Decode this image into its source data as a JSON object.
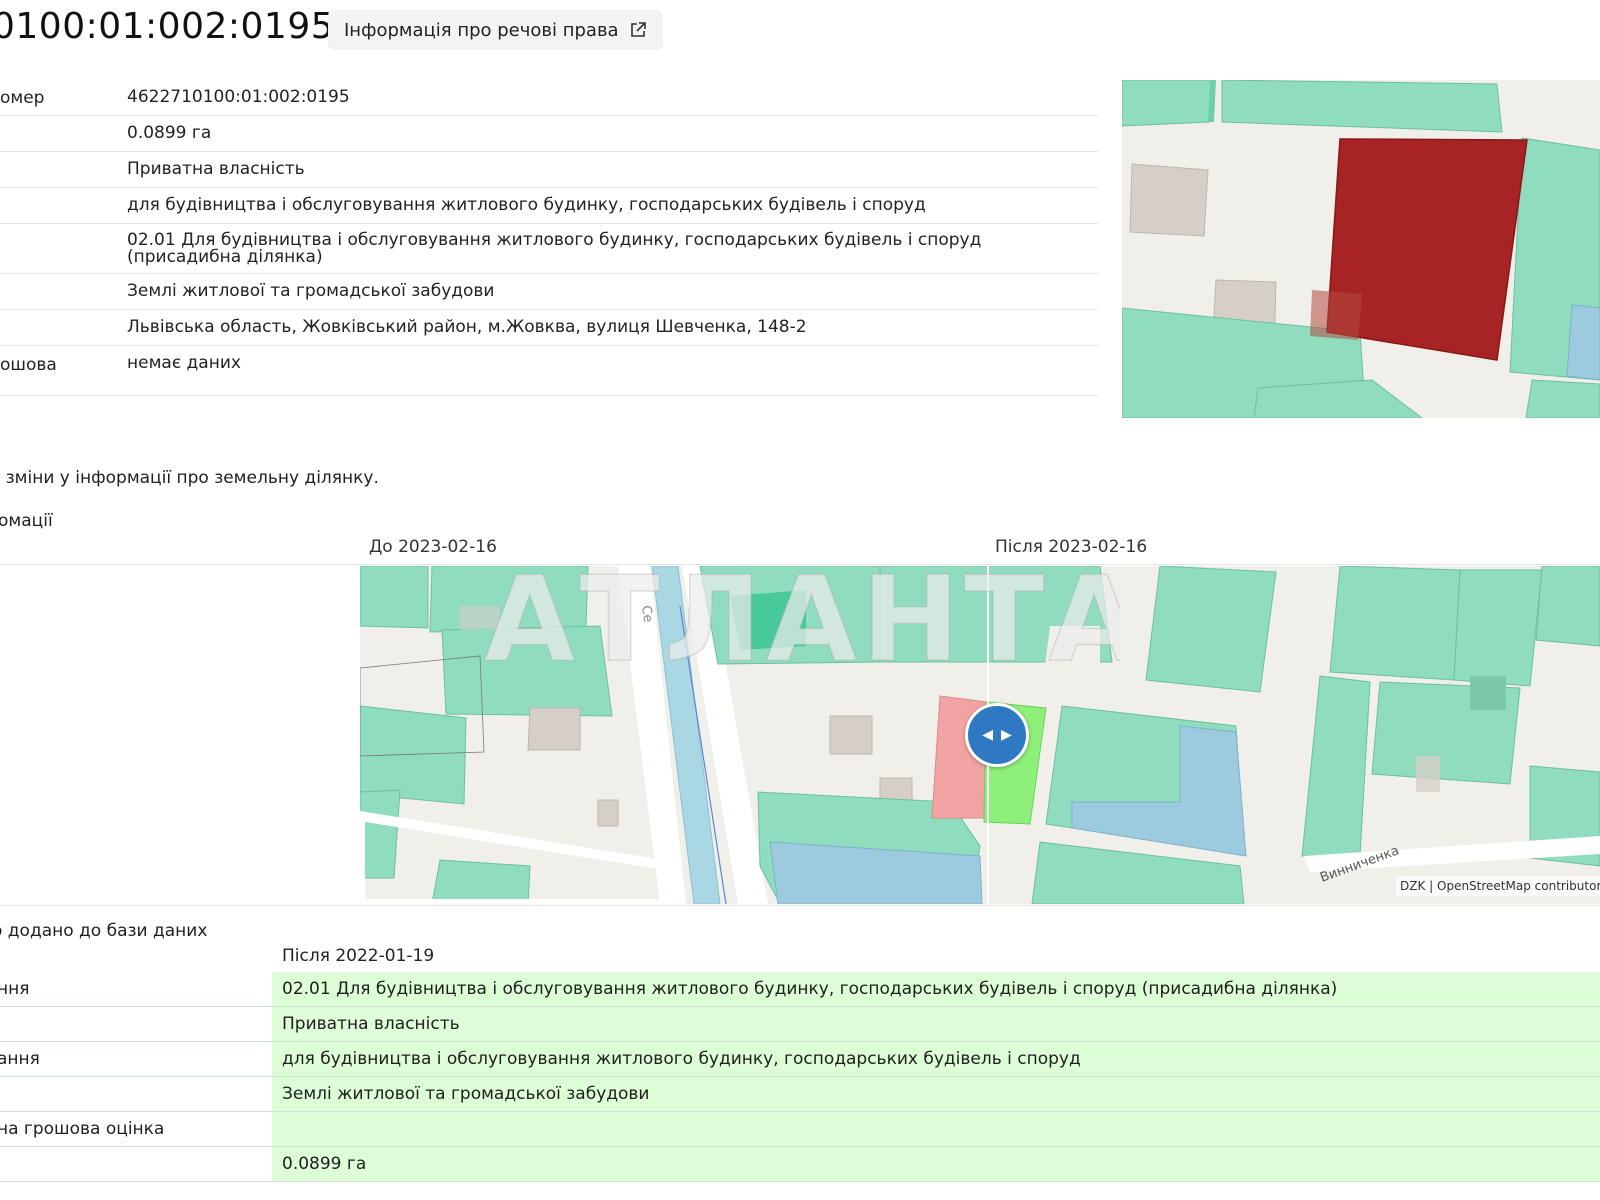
{
  "header": {
    "parcel_number": "0100:01:002:0195",
    "rights_button_label": "Інформація про речові права",
    "rights_button_icon": "external-link-icon"
  },
  "info_table": [
    {
      "label": "омер",
      "value": "4622710100:01:002:0195"
    },
    {
      "label": "",
      "value": "0.0899 га"
    },
    {
      "label": "",
      "value": "Приватна власність"
    },
    {
      "label": "",
      "value": "для будівництва і обслуговування житлового будинку, господарських будівель і споруд"
    },
    {
      "label": "",
      "value": "02.01 Для будівництва і обслуговування житлового будинку, господарських будівель і споруд (присадибна ділянка)"
    },
    {
      "label": "",
      "value": "Землі житлової та громадської забудови"
    },
    {
      "label": "",
      "value": "Львівська область, Жовківський район, м.Жовква, вулиця Шевченка, 148-2"
    },
    {
      "label": "ошова",
      "value": "немає даних"
    }
  ],
  "history": {
    "heading": "я зміни у інформації про земельну ділянку.",
    "subheading": "омації",
    "before_label": "До 2023-02-16",
    "after_label": "Після 2023-02-16",
    "slider_icon": "swap-arrows-icon",
    "map_attribution": "DZK | OpenStreetMap contributors",
    "street_label": "Винниченка",
    "street_label_left": "Се"
  },
  "watermark": "АТЛАНТА",
  "added": {
    "heading": "о додано до бази даних",
    "column_header": "Після 2022-01-19",
    "rows": [
      {
        "label": "ння",
        "value": "02.01 Для будівництва і обслуговування житлового будинку, господарських будівель і споруд (присадибна ділянка)"
      },
      {
        "label": "",
        "value": "Приватна власність"
      },
      {
        "label": "ання",
        "value": "для будівництва і обслуговування житлового будинку, господарських будівель і споруд"
      },
      {
        "label": "",
        "value": "Землі житлової та громадської забудови"
      },
      {
        "label": "на грошова оцінка",
        "value": ""
      },
      {
        "label": "",
        "value": "0.0899 га"
      }
    ]
  },
  "colors": {
    "parcel_highlight": "#a82424",
    "parcel_green": "#8fdcbe",
    "building_grey": "#d6cfc8",
    "after_parcel": "#8ef07a",
    "before_parcel": "#f0a0a0",
    "added_row_bg": "#dcfdd6",
    "slider_blue": "#2f78c4"
  }
}
